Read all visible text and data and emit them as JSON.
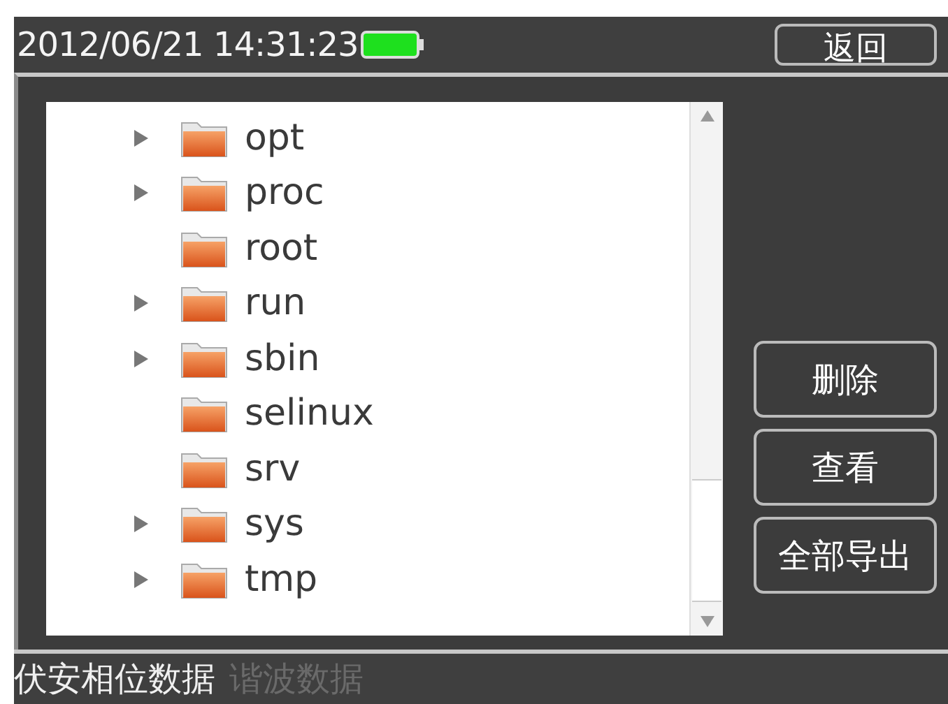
{
  "header": {
    "datetime": "2012/06/21 14:31:23",
    "back_button": "返回"
  },
  "tree": {
    "items": [
      {
        "name": "opt",
        "expandable": true
      },
      {
        "name": "proc",
        "expandable": true
      },
      {
        "name": "root",
        "expandable": false
      },
      {
        "name": "run",
        "expandable": true
      },
      {
        "name": "sbin",
        "expandable": true
      },
      {
        "name": "selinux",
        "expandable": false
      },
      {
        "name": "srv",
        "expandable": false
      },
      {
        "name": "sys",
        "expandable": true
      },
      {
        "name": "tmp",
        "expandable": true
      }
    ]
  },
  "buttons": [
    "删除",
    "查看",
    "全部导出"
  ],
  "tabs": [
    {
      "label": "伏安相位数据",
      "selected": true
    },
    {
      "label": "谐波数据",
      "selected": false
    }
  ]
}
